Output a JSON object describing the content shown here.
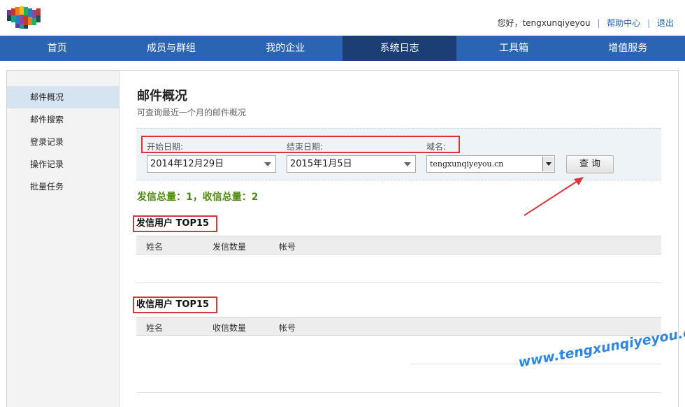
{
  "header": {
    "greeting": "您好，tengxunqiyeyou",
    "help_link": "帮助中心",
    "logout_link": "退出",
    "separator": "|"
  },
  "nav": {
    "items": [
      {
        "label": "首页"
      },
      {
        "label": "成员与群组"
      },
      {
        "label": "我的企业"
      },
      {
        "label": "系统日志"
      },
      {
        "label": "工具箱"
      },
      {
        "label": "增值服务"
      }
    ],
    "active_index": 3
  },
  "sidebar": {
    "items": [
      {
        "label": "邮件概况"
      },
      {
        "label": "邮件搜索"
      },
      {
        "label": "登录记录"
      },
      {
        "label": "操作记录"
      },
      {
        "label": "批量任务"
      }
    ],
    "active_index": 0
  },
  "main": {
    "title": "邮件概况",
    "subtitle": "可查询最近一个月的邮件概况",
    "filters": {
      "start_label": "开始日期:",
      "end_label": "结束日期:",
      "domain_label": "域名:",
      "start_value": "2014年12月29日",
      "end_value": "2015年1月5日",
      "domain_value": "tengxunqiyeyou.cn",
      "query_button": "查 询"
    },
    "totals": "发信总量：1，收信总量：2",
    "sent_table": {
      "title": "发信用户 TOP15",
      "columns": [
        "姓名",
        "发信数量",
        "帐号"
      ]
    },
    "received_table": {
      "title": "收信用户 TOP15",
      "columns": [
        "姓名",
        "收信数量",
        "帐号"
      ]
    }
  },
  "watermark": "www.tengxunqiyeyou.com",
  "colors": {
    "nav_bg": "#2b64b3",
    "nav_active": "#1b3f74",
    "accent_link": "#1d5fae",
    "highlight_border": "#d9353a",
    "totals_green": "#4f8a10",
    "watermark_blue": "#2f86e0"
  }
}
